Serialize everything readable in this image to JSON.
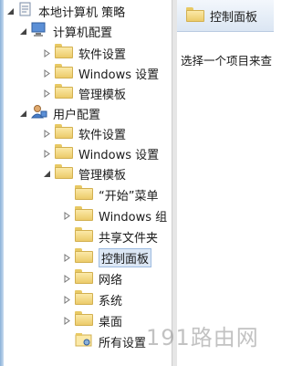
{
  "tree": {
    "root": {
      "label": "本地计算机 策略",
      "icon": "policy-document-icon"
    },
    "computer_config": {
      "label": "计算机配置",
      "icon": "computer-icon"
    },
    "computer_children": [
      {
        "label": "软件设置"
      },
      {
        "label": "Windows 设置"
      },
      {
        "label": "管理模板"
      }
    ],
    "user_config": {
      "label": "用户配置",
      "icon": "user-icon"
    },
    "user_children": [
      {
        "label": "软件设置"
      },
      {
        "label": "Windows 设置"
      },
      {
        "label": "管理模板"
      }
    ],
    "admin_templates_children": [
      {
        "label": "“开始”菜单"
      },
      {
        "label": "Windows 组"
      },
      {
        "label": "共享文件夹"
      },
      {
        "label": "控制面板"
      },
      {
        "label": "网络"
      },
      {
        "label": "系统"
      },
      {
        "label": "桌面"
      },
      {
        "label": "所有设置"
      }
    ]
  },
  "right_pane": {
    "header_title": "控制面板",
    "description": "选择一个项目来查"
  },
  "watermark": "191路由网",
  "colors": {
    "selection_bg": "#dce7f5",
    "header_bg": "#dbe6f3"
  }
}
